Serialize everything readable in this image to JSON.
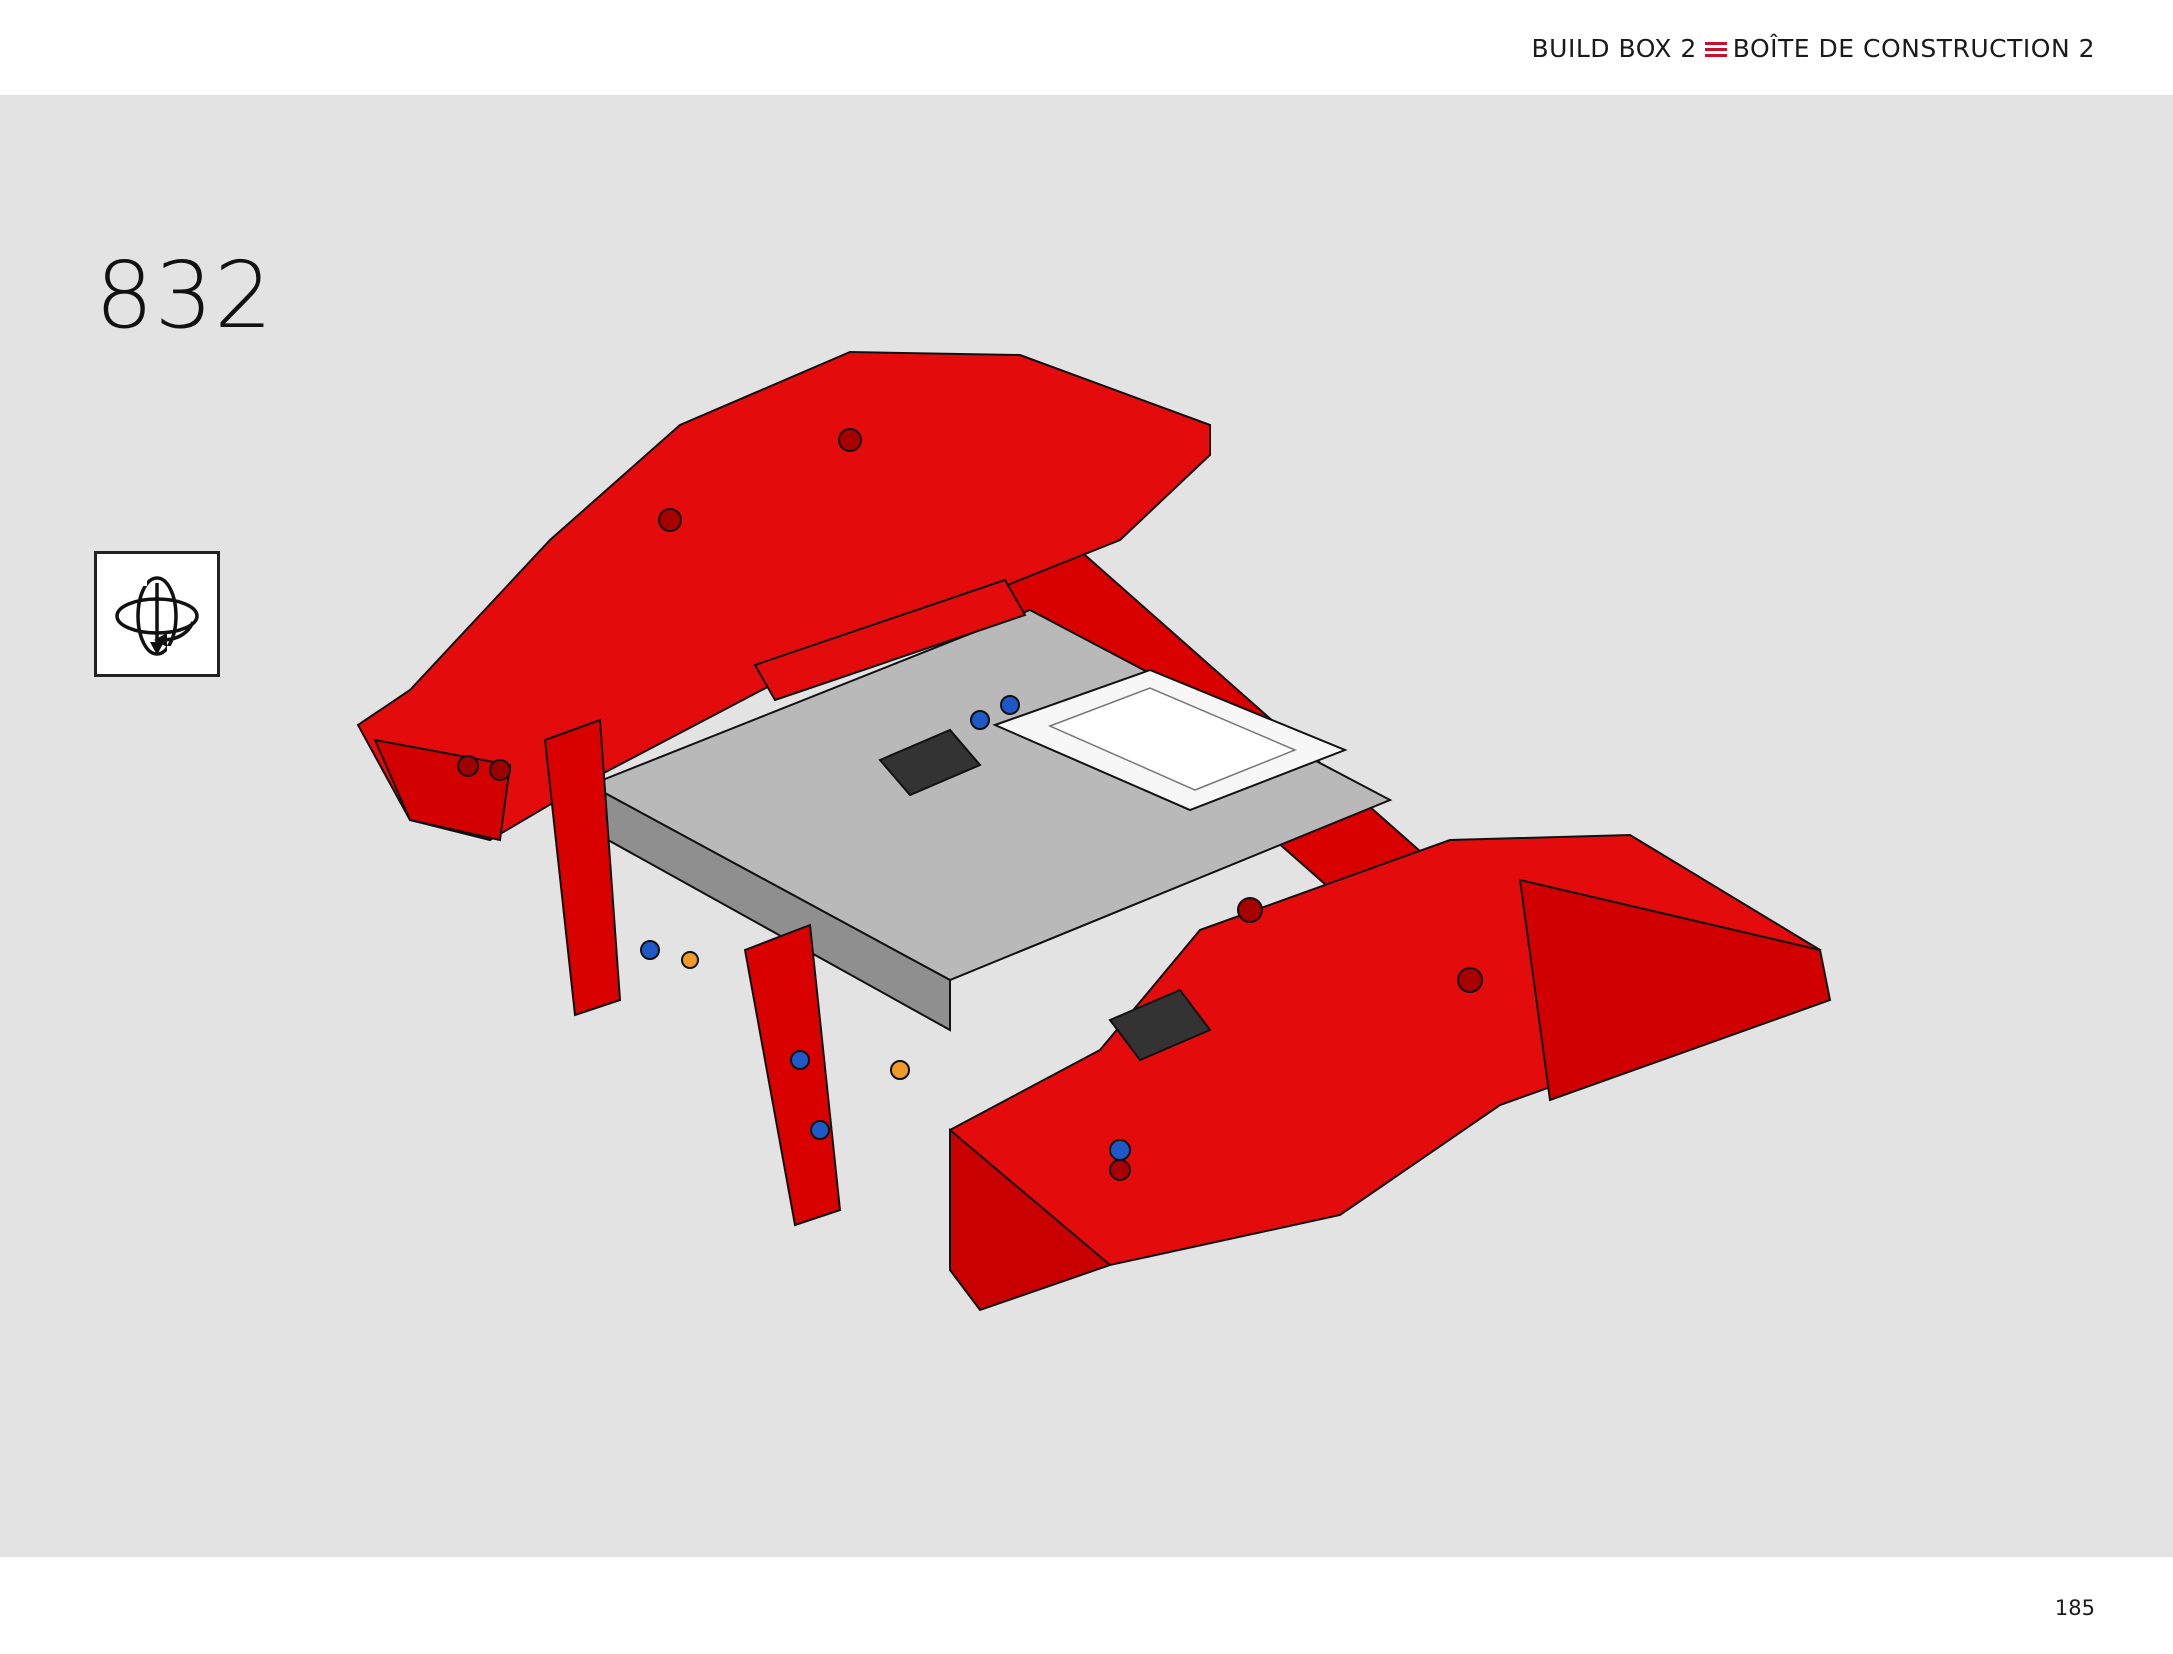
{
  "header": {
    "build_box_en": "BUILD BOX 2",
    "build_box_fr": "BOÎTE DE CONSTRUCTION 2",
    "divider_icon": "three-red-lines-icon",
    "accent_color": "#c8102e"
  },
  "step": {
    "number": "832",
    "rotate_icon": "rotate-model-icon"
  },
  "illustration": {
    "subject": "lego-technic-assembly",
    "primary_color": "#e3000b",
    "secondary_color": "#a8a8a8"
  },
  "footer": {
    "page_number": "185"
  },
  "colors": {
    "background": "#e3e3e3",
    "page": "#ffffff",
    "text": "#111111"
  }
}
